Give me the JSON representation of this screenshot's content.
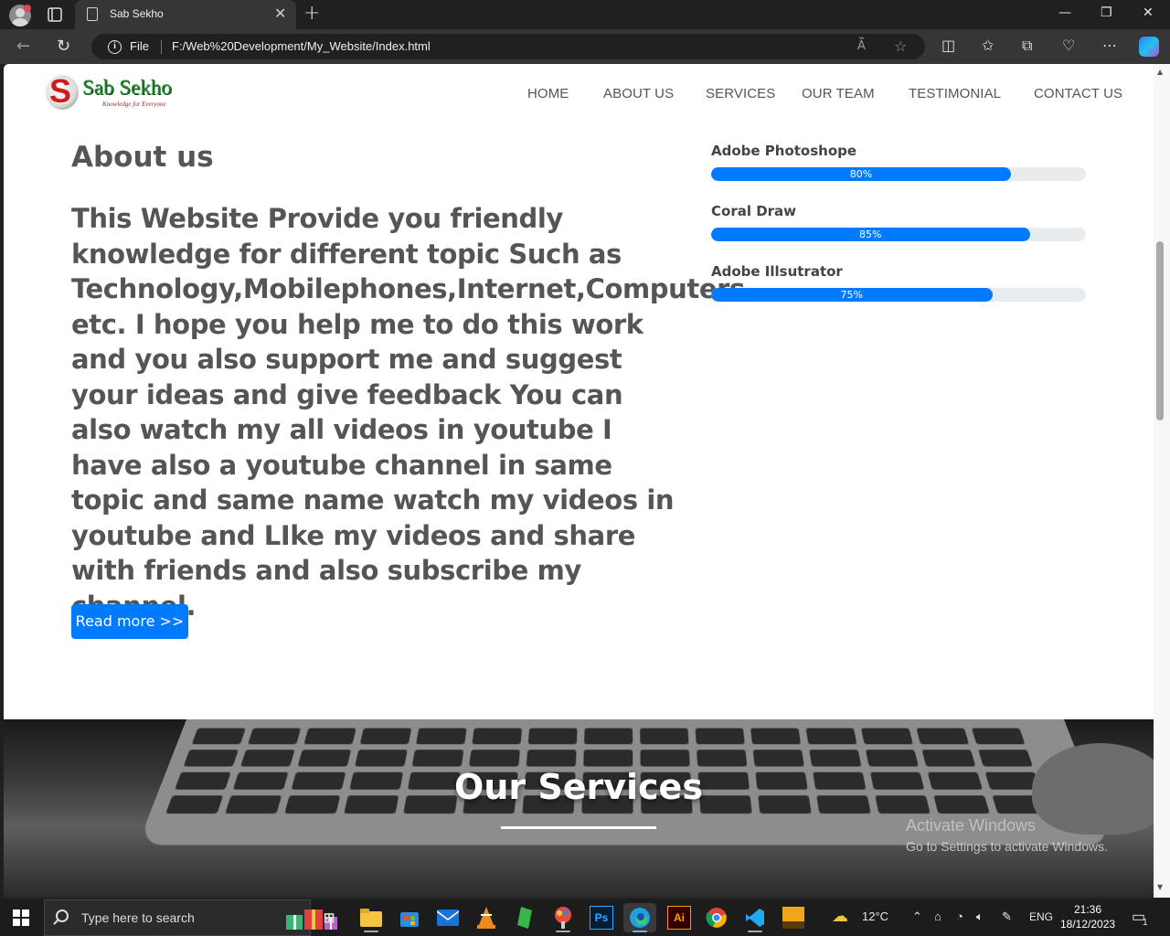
{
  "browser": {
    "tab_title": "Sab Sekho",
    "address_prefix": "File",
    "url": "F:/Web%20Development/My_Website/Index.html"
  },
  "site": {
    "logo": {
      "letter": "S",
      "brand": "Sab Sekho",
      "tagline": "Knowledge for Everyone"
    },
    "nav": [
      {
        "label": "HOME"
      },
      {
        "label": "ABOUT US"
      },
      {
        "label": "SERVICES"
      },
      {
        "label": "OUR TEAM"
      },
      {
        "label": "TESTIMONIAL"
      },
      {
        "label": "CONTACT US"
      }
    ],
    "about": {
      "title": "About us",
      "text": "This Website Provide you friendly knowledge for different topic Such as Technology,Mobilephones,Internet,Computers etc. I hope you help me to do this work and you also support me and suggest your ideas and give feedback You can also watch my all videos in youtube I have also a youtube channel in same topic and same name watch my videos in youtube and LIke my videos and share with friends and also subscribe my channel.",
      "button": "Read more >>"
    },
    "skills": [
      {
        "name": "Adobe Photoshope",
        "percent": 80,
        "label": "80%"
      },
      {
        "name": "Coral Draw",
        "percent": 85,
        "label": "85%"
      },
      {
        "name": "Adobe Illsutrator",
        "percent": 75,
        "label": "75%"
      }
    ],
    "services": {
      "title": "Our Services"
    }
  },
  "watermark": {
    "line1": "Activate Windows",
    "line2": "Go to Settings to activate Windows."
  },
  "taskbar": {
    "search_placeholder": "Type here to search",
    "weather": "12°C",
    "language": "ENG",
    "time": "21:36",
    "date": "18/12/2023",
    "notifications": "1"
  },
  "colors": {
    "accent": "#007bff",
    "text": "#555555",
    "brand_green": "#1e8a2e",
    "brand_red": "#d11a1a"
  }
}
